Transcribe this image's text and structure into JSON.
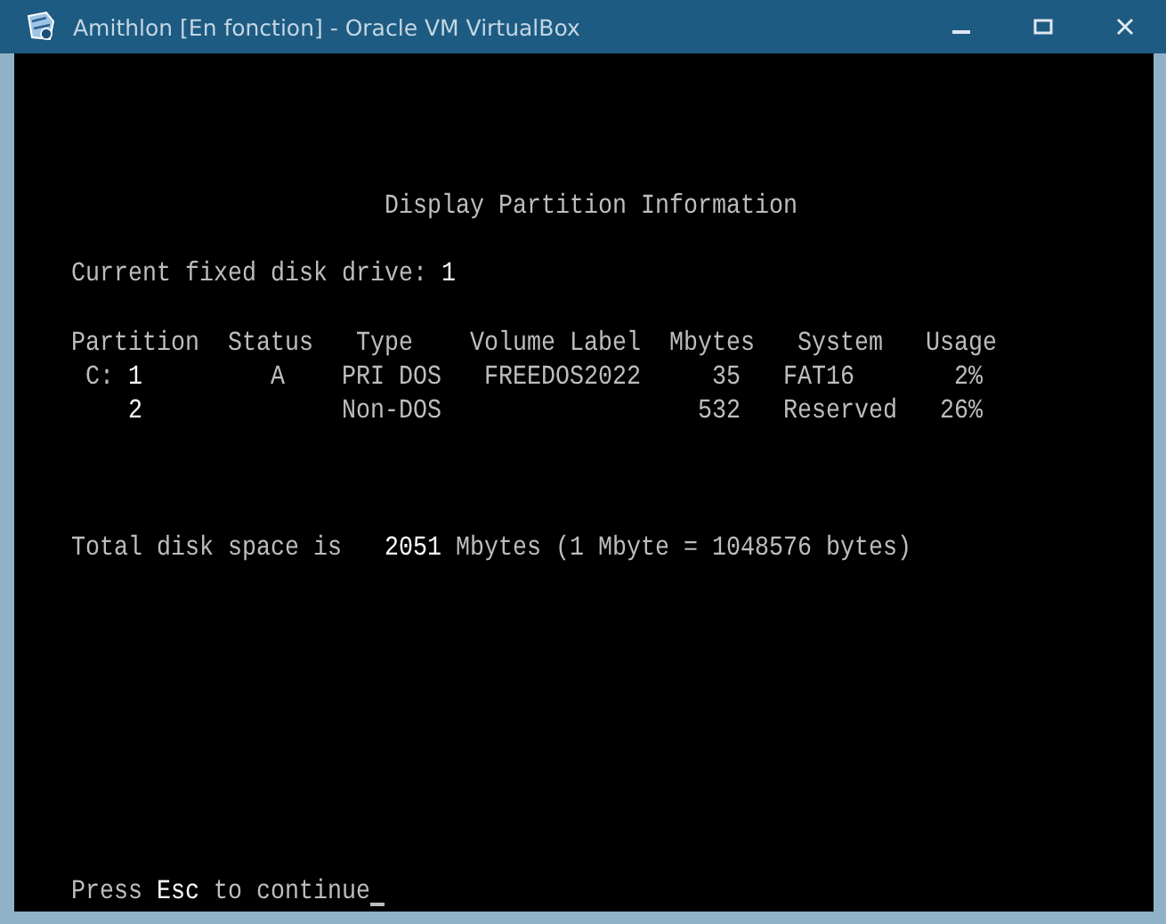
{
  "window": {
    "title": "Amithlon [En fonction] - Oracle VM VirtualBox"
  },
  "screen": {
    "heading": "Display Partition Information",
    "drive": {
      "label": "Current fixed disk drive:",
      "value": "1"
    },
    "columns": [
      "Partition",
      "Status",
      "Type",
      "Volume Label",
      "Mbytes",
      "System",
      "Usage"
    ],
    "partitions": [
      {
        "drive_letter": "C:",
        "number": "1",
        "status": "A",
        "type": "PRI DOS",
        "volume_label": "FREEDOS2022",
        "mbytes": "35",
        "system": "FAT16",
        "usage": "2%"
      },
      {
        "number": "2",
        "type": "Non-DOS",
        "mbytes": "532",
        "system": "Reserved",
        "usage": "26%"
      }
    ],
    "total": {
      "label": "Total disk space is",
      "value": "2051",
      "unit": "Mbytes (1 Mbyte = 1048576 bytes)"
    },
    "prompt": "Press **Esc** to continue"
  }
}
